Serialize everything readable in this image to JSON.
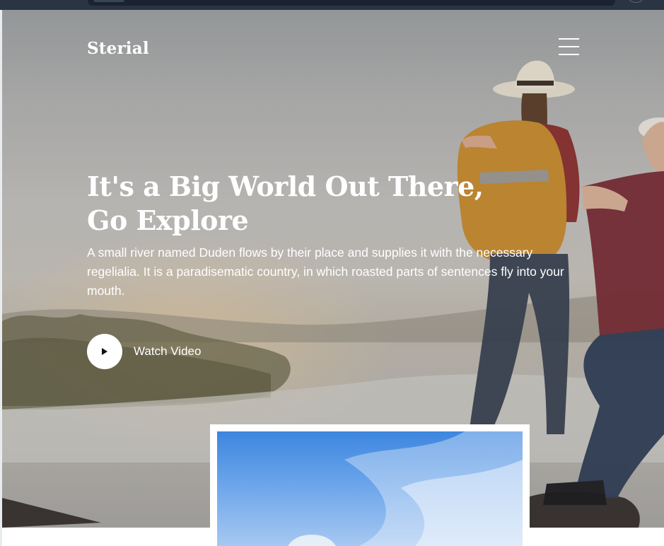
{
  "brand": {
    "logo_text": "Sterial"
  },
  "hero": {
    "headline": "It's a Big World Out There, Go Explore",
    "subtext": "A small river named Duden flows by their place and supplies it with the necessary regelialia. It is a paradisematic country, in which roasted parts of sentences fly into your mouth.",
    "watch_video_label": "Watch Video"
  },
  "icons": {
    "menu": "hamburger-menu-icon",
    "play": "play-icon"
  },
  "colors": {
    "text_on_hero": "#ffffff",
    "browser_bar": "#2b3442"
  }
}
